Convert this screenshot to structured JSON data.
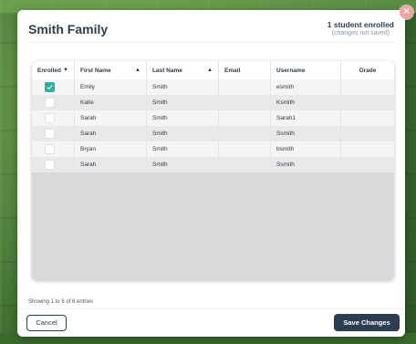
{
  "modal": {
    "title": "Smith Family",
    "enrolled_count": "1 student enrolled",
    "unsaved_note": "(changes not saved)"
  },
  "table": {
    "columns": {
      "enrolled": "Enrolled",
      "first_name": "First Name",
      "last_name": "Last Name",
      "email": "Email",
      "username": "Username",
      "grade": "Grade"
    },
    "rows": [
      {
        "enrolled": true,
        "first_name": "Emily",
        "last_name": "Smith",
        "email": "",
        "username": "esmith",
        "grade": ""
      },
      {
        "enrolled": false,
        "first_name": "Katie",
        "last_name": "Smith",
        "email": "",
        "username": "Ksmith",
        "grade": ""
      },
      {
        "enrolled": false,
        "first_name": "Sarah",
        "last_name": "Smith",
        "email": "",
        "username": "Sarah1",
        "grade": ""
      },
      {
        "enrolled": false,
        "first_name": "Sarah",
        "last_name": "Smith",
        "email": "",
        "username": "Ssmith",
        "grade": ""
      },
      {
        "enrolled": false,
        "first_name": "Bryan",
        "last_name": "Smith",
        "email": "",
        "username": "bsmith",
        "grade": ""
      },
      {
        "enrolled": false,
        "first_name": "Sarah",
        "last_name": "Smith",
        "email": "",
        "username": "Ssmith",
        "grade": ""
      }
    ]
  },
  "footer": {
    "entries_info": "Showing 1 to 6 of 6 entries",
    "cancel_label": "Cancel",
    "save_label": "Save Changes"
  },
  "icons": {
    "close": "close-icon",
    "sort_desc": "sort-desc-icon",
    "sort_asc": "sort-asc-icon",
    "checkbox_checked": "check-icon"
  },
  "colors": {
    "primary": "#2d3e50",
    "checkbox_checked": "#2cb0a0",
    "close_button": "#f0a2a2"
  }
}
